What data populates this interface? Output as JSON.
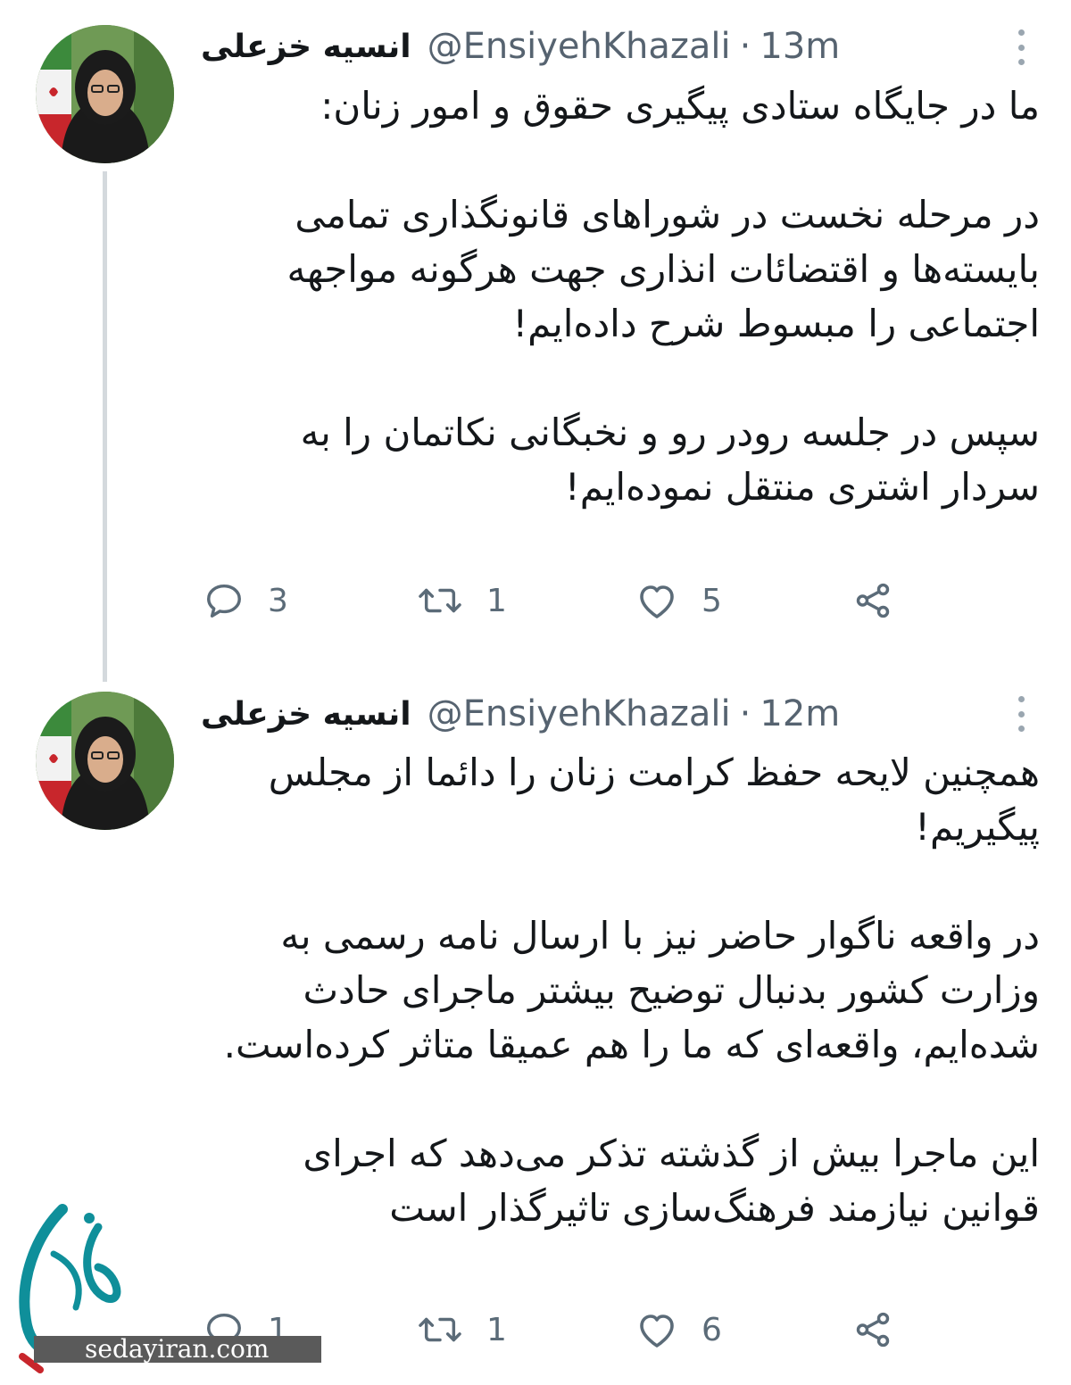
{
  "tweets": [
    {
      "name": "انسیه خزعلی",
      "handle": "@EnsiyehKhazali",
      "time": "13m",
      "text": "ما در جایگاه ستادی پیگیری حقوق و امور زنان:\n\nدر مرحله نخست در شوراهای قانونگذاری تمامی بایسته‌ها و اقتضائات انذاری جهت هرگونه مواجهه اجتماعی را مبسوط شرح داده‌ایم!\n\nسپس در جلسه رودر رو و نخبگانی نکاتمان را به سردار اشتری منتقل نموده‌ایم!",
      "replies": "3",
      "retweets": "1",
      "likes": "5"
    },
    {
      "name": "انسیه خزعلی",
      "handle": "@EnsiyehKhazali",
      "time": "12m",
      "text": "همچنین لایحه حفظ کرامت زنان را دائما از مجلس پیگیریم!\n\nدر واقعه ناگوار حاضر نیز با ارسال نامه رسمی به وزارت کشور بدنبال توضیح بیشتر ماجرای حادث شده‌ایم، واقعه‌ای که ما را هم عمیقا متاثر کرده‌است.\n\nاین ماجرا بیش از گذشته تذکر می‌دهد که اجرای قوانین نیازمند فرهنگ‌سازی تاثیرگذار است",
      "replies": "1",
      "retweets": "1",
      "likes": "6"
    }
  ],
  "separator": "·",
  "icons": {
    "reply": "reply-bubble-icon",
    "retweet": "retweet-icon",
    "like": "heart-icon",
    "share": "share-icon",
    "more": "more-vertical-icon"
  },
  "watermark": {
    "site": "sedayiran.com"
  },
  "colors": {
    "text": "#14171a",
    "secondary": "#566370",
    "icon": "#5b6b78",
    "thread_line": "#d4d9dd"
  }
}
